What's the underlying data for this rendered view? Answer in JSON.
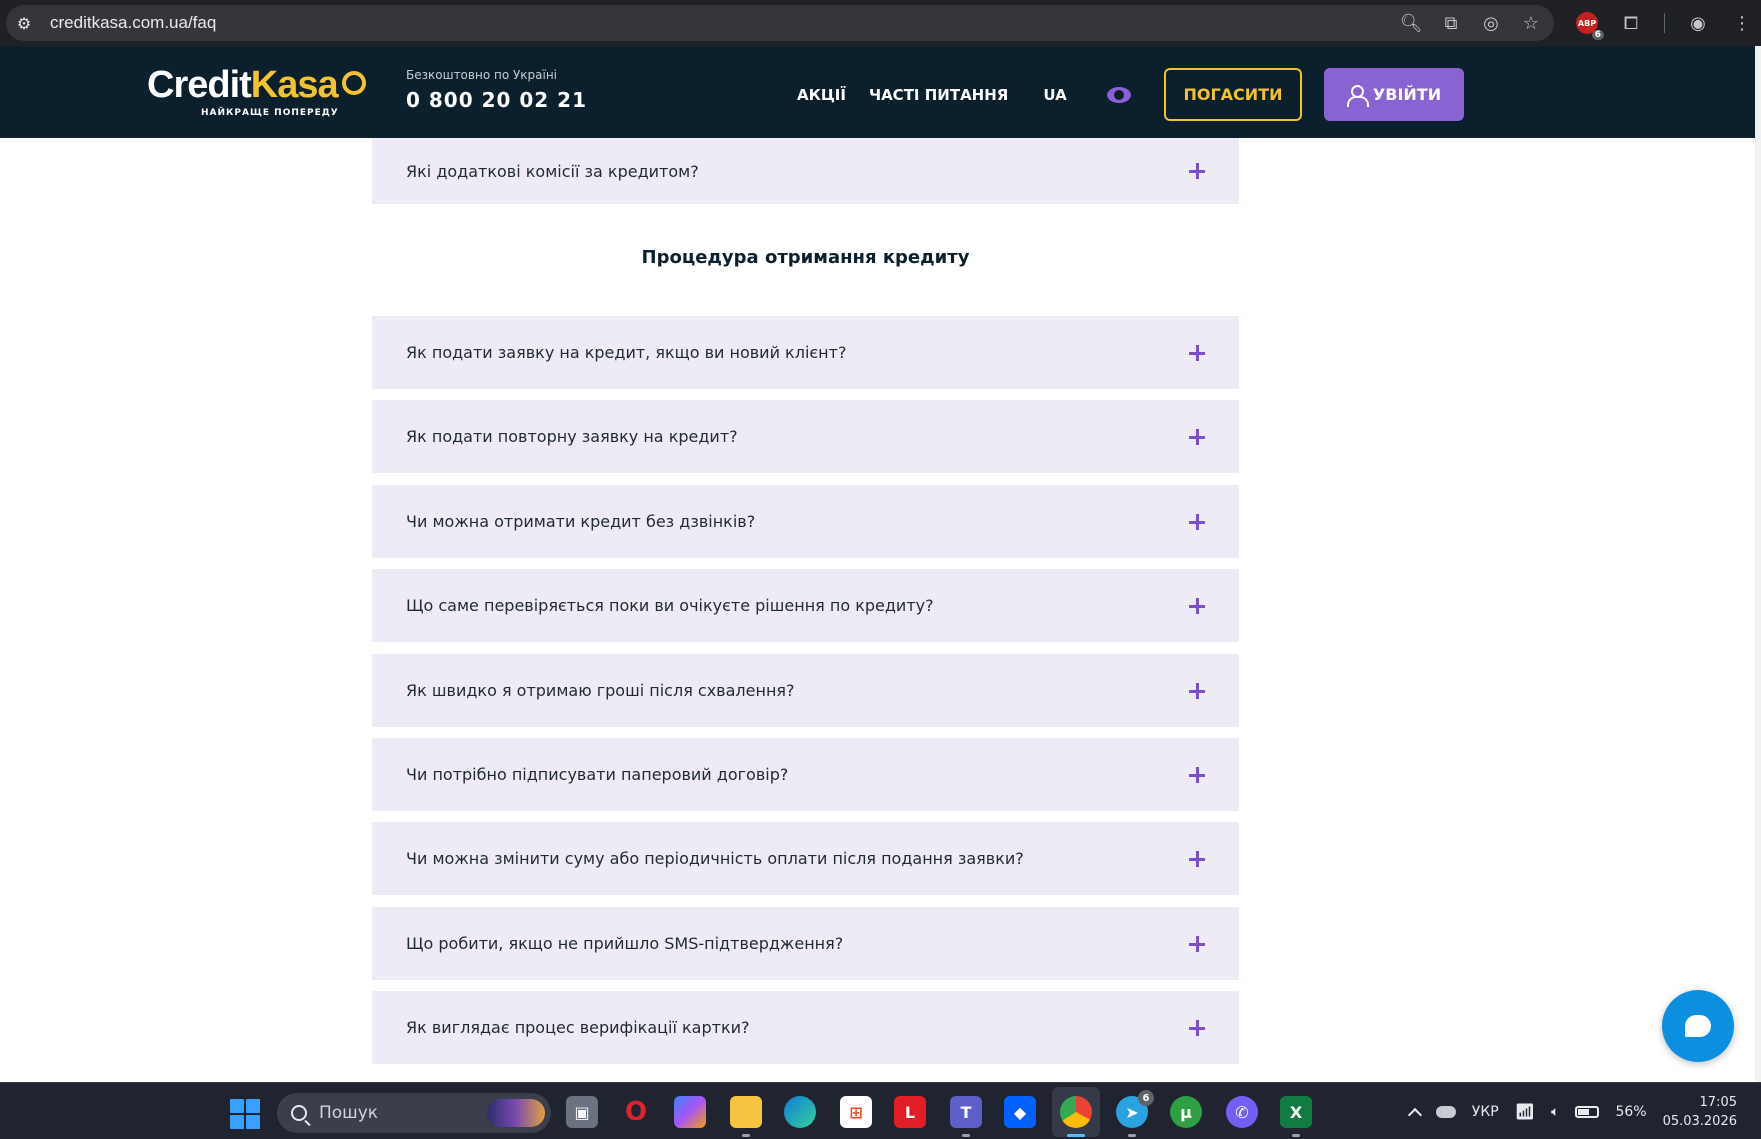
{
  "browser": {
    "url": "creditkasa.com.ua/faq",
    "extension_badge_label": "ABP",
    "extension_badge_count": "6"
  },
  "header": {
    "logo_credit": "Credit",
    "logo_kasa": "Kasa",
    "tagline": "НАЙКРАЩЕ ПОПЕРЕДУ",
    "phone_caption": "Безкоштовно по Україні",
    "phone_number": "0 800 20 02 21",
    "nav": [
      "АКЦІЇ",
      "ЧАСТІ ПИТАННЯ"
    ],
    "lang": "UA",
    "pay_label": "ПОГАСИТИ",
    "login_label": "УВІЙТИ"
  },
  "faq": {
    "previous_item": "Які додаткові комісії за кредитом?",
    "section_title": "Процедура отримання кредиту",
    "items": [
      "Як подати заявку на кредит, якщо ви новий клієнт?",
      "Як подати повторну заявку на кредит?",
      "Чи можна отримати кредит без дзвінків?",
      "Що саме перевіряється поки ви очікуєте рішення по кредиту?",
      "Як швидко я отримаю гроші після схвалення?",
      "Чи потрібно підписувати паперовий договір?",
      "Чи можна змінити суму або періодичність оплати після подання заявки?",
      "Що робити, якщо не прийшло SMS-підтвердження?",
      "Як виглядає процес верифікації картки?"
    ]
  },
  "taskbar": {
    "search_placeholder": "Пошук",
    "lang": "УКР",
    "battery": "56%",
    "time": "17:05",
    "date": "05.03.2026",
    "telegram_badge": "6"
  },
  "colors": {
    "header_bg": "#0b1f2c",
    "accent_yellow": "#f2c230",
    "accent_purple": "#8a63d2",
    "faq_bg": "#efebf6",
    "chat_blue": "#0d8fe0"
  }
}
